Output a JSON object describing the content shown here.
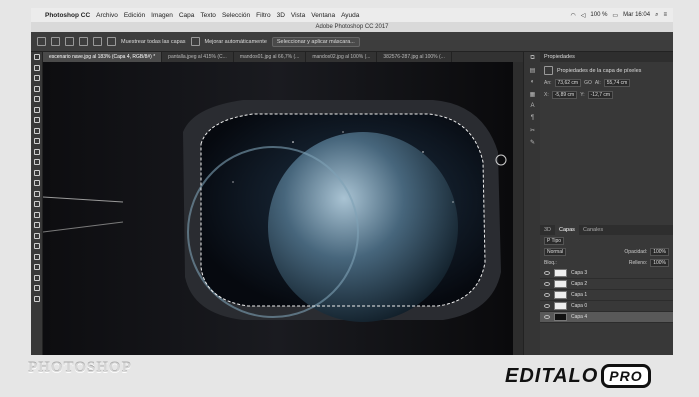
{
  "menubar": {
    "app": "Photoshop CC",
    "items": [
      "Archivo",
      "Edición",
      "Imagen",
      "Capa",
      "Texto",
      "Selección",
      "Filtro",
      "3D",
      "Vista",
      "Ventana",
      "Ayuda"
    ],
    "battery": "100 %",
    "clock": "Mar 16:04"
  },
  "window": {
    "title": "Adobe Photoshop CC 2017"
  },
  "options": {
    "sample_label": "Muestrear todas las capas",
    "refine_label": "Mejorar automáticamente",
    "mask_label": "Seleccionar y aplicar máscara..."
  },
  "tabs": [
    "escenario nave.jpg al 183% (Capa 4, RGB/8#) *",
    "pantalla.jpeg al 415% (C...",
    "mandos01.jpg al 66,7% (...",
    "mandos02.jpg al 100% (...",
    "382576-287.jpg al 100% (..."
  ],
  "properties": {
    "title": "Propiedades",
    "subtitle": "Propiedades de la capa de píxeles",
    "w_label": "An:",
    "w_val": "73,62 cm",
    "link": "GO",
    "h_label": "Al:",
    "h_val": "55,74 cm",
    "x_label": "X:",
    "x_val": "-5,89 cm",
    "y_label": "Y:",
    "y_val": "-12,7 cm"
  },
  "layers_panel": {
    "tab_3d": "3D",
    "tab_layers": "Capas",
    "tab_channels": "Canales",
    "filter": "P Tipo",
    "blend": "Normal",
    "opacity_label": "Opacidad:",
    "opacity_val": "100%",
    "lock_label": "Bloq.:",
    "fill_label": "Relleno:",
    "fill_val": "100%",
    "layers": [
      "Capa 3",
      "Capa 2",
      "Capa 1",
      "Capa 0",
      "Capa 4"
    ]
  },
  "watermark": {
    "left": "PHOTOSHOP",
    "logo": "EDITALO",
    "logo_pro": "PRO"
  }
}
